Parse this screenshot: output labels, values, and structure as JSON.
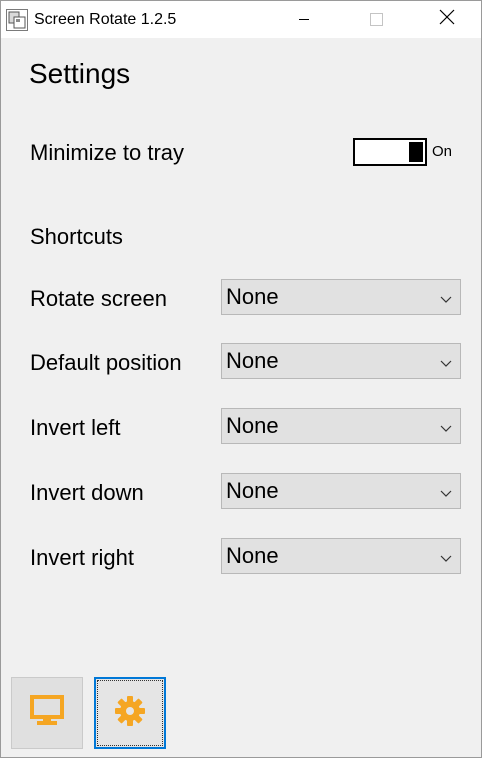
{
  "window": {
    "title": "Screen Rotate 1.2.5"
  },
  "page": {
    "heading": "Settings"
  },
  "tray": {
    "label": "Minimize to tray",
    "state_label": "On",
    "enabled": true
  },
  "shortcuts": {
    "heading": "Shortcuts",
    "items": [
      {
        "label": "Rotate screen",
        "value": "None"
      },
      {
        "label": "Default position",
        "value": "None"
      },
      {
        "label": "Invert left",
        "value": "None"
      },
      {
        "label": "Invert down",
        "value": "None"
      },
      {
        "label": "Invert right",
        "value": "None"
      }
    ]
  },
  "nav": {
    "items": [
      {
        "icon": "monitor-icon",
        "selected": false
      },
      {
        "icon": "gear-icon",
        "selected": true
      }
    ]
  },
  "colors": {
    "accent": "#f5a623",
    "focus": "#0078d7",
    "background": "#f0f0f0",
    "control": "#e1e1e1"
  }
}
